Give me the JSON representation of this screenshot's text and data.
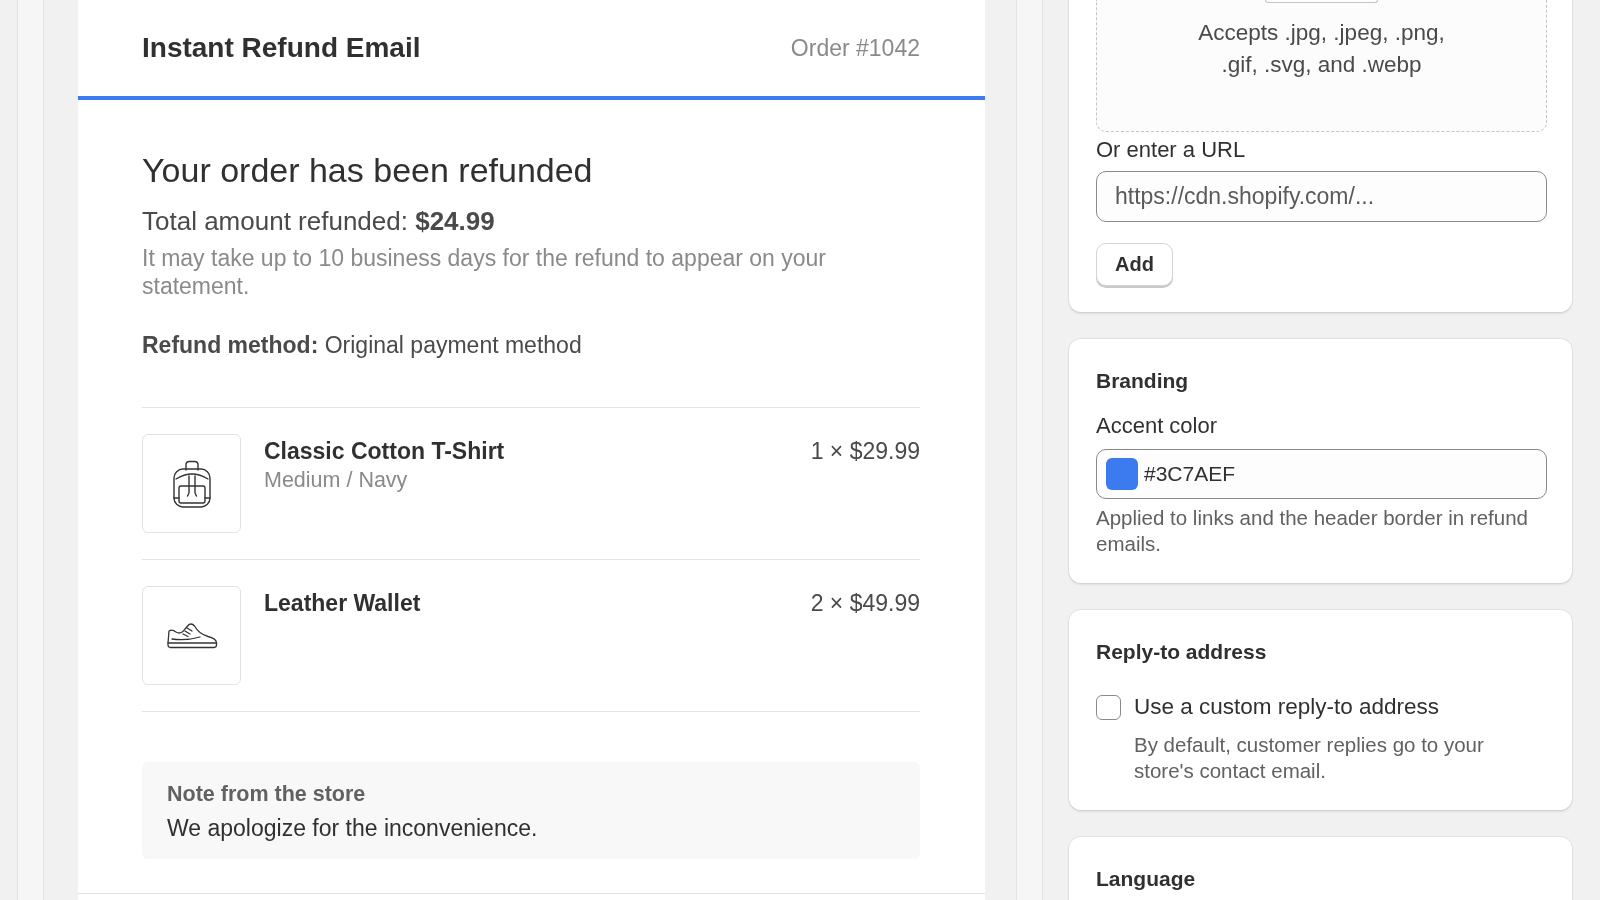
{
  "email_preview": {
    "header": {
      "title": "Instant Refund Email",
      "order_number": "Order #1042"
    },
    "heading": "Your order has been refunded",
    "total": "Total amount refunded: **$24.99**",
    "notice": "It may take up to 10 business days for the refund to appear on your statement.",
    "refund_method": "**Refund method:** Original payment method",
    "line_items": [
      {
        "name": "Classic Cotton T-Shirt",
        "variant": "Medium / Navy",
        "quantity_price": "1 × $29.99"
      },
      {
        "name": "Leather Wallet",
        "quantity_price": "2 × $49.99"
      }
    ],
    "note": {
      "title": "Note from the store",
      "text": "We apologize for the inconvenience."
    }
  },
  "settings": {
    "image_upload": {
      "accepted_formats": "Accepts .jpg, .jpeg, .png, .gif, .svg, and .webp",
      "url_label": "Or enter a URL",
      "url_placeholder": "https://cdn.shopify.com/...",
      "add_button": "Add"
    },
    "branding": {
      "title": "Branding",
      "accent_color": {
        "label": "Accent color",
        "value": "#3C7AEF",
        "color": "#3c7aef",
        "help": "Applied to links and the header border in refund emails."
      }
    },
    "reply_to": {
      "title": "Reply-to address",
      "custom": {
        "label": "Use a custom reply-to address",
        "checked": false,
        "help": "By default, customer replies go to your store's contact email."
      }
    },
    "language": {
      "title": "Language"
    }
  }
}
